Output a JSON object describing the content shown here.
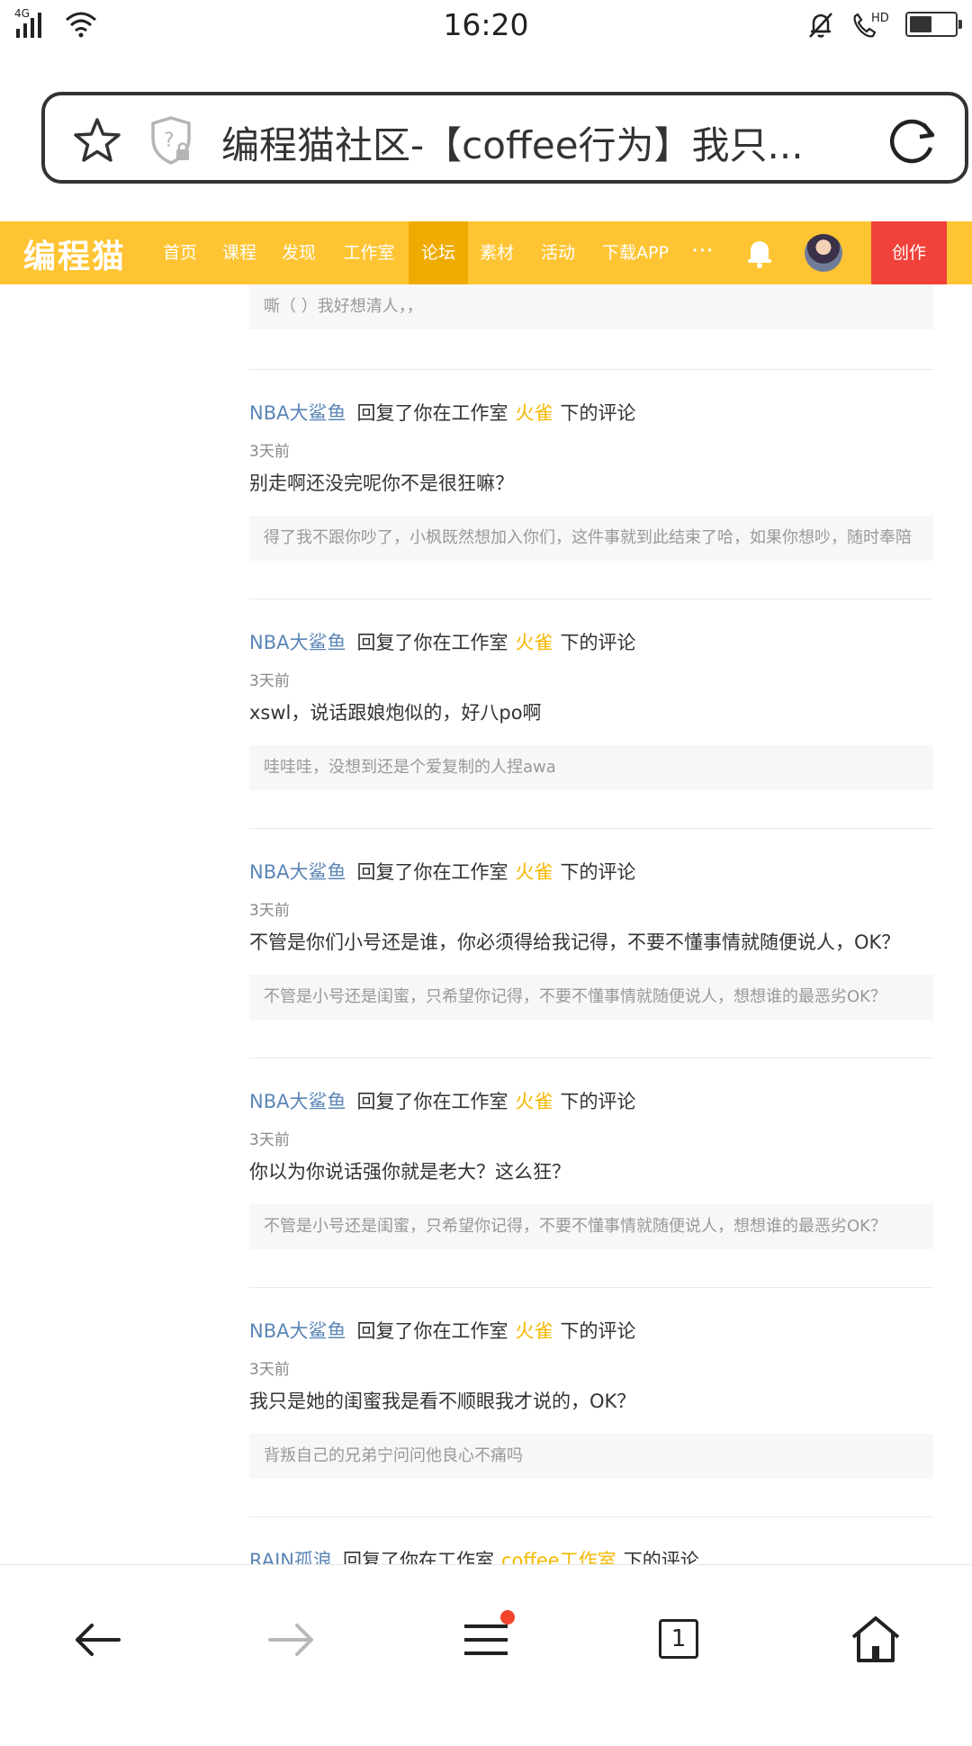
{
  "status_bar": {
    "network": "4G",
    "time": "16:20",
    "battery_level": 0.55
  },
  "address_bar": {
    "title": "编程猫社区-【coffee行为】我只..."
  },
  "site_nav": {
    "logo": "编程猫",
    "items": [
      "首页",
      "课程",
      "发现",
      "工作室",
      "论坛",
      "素材",
      "活动",
      "下载APP"
    ],
    "active_item": "论坛",
    "more": "···",
    "create_label": "创作"
  },
  "feed": {
    "top_quote": "嘶（ ）我好想清人，，",
    "notifications": [
      {
        "user": "NBA大鲨鱼",
        "action": "回复了你在工作室",
        "studio": "火雀",
        "suffix": "下的评论",
        "time": "3天前",
        "message": "别走啊还没完呢你不是很狂嘛？",
        "quote": "得了我不跟你吵了，小枫既然想加入你们，这件事就到此结束了哈，如果你想吵，随时奉陪"
      },
      {
        "user": "NBA大鲨鱼",
        "action": "回复了你在工作室",
        "studio": "火雀",
        "suffix": "下的评论",
        "time": "3天前",
        "message": "xswl，说话跟娘炮似的，好八po啊",
        "quote": "哇哇哇，没想到还是个爱复制的人捏awa"
      },
      {
        "user": "NBA大鲨鱼",
        "action": "回复了你在工作室",
        "studio": "火雀",
        "suffix": "下的评论",
        "time": "3天前",
        "message": "不管是你们小号还是谁，你必须得给我记得，不要不懂事情就随便说人，OK？",
        "quote": "不管是小号还是闺蜜，只希望你记得，不要不懂事情就随便说人，想想谁的最恶劣OK？"
      },
      {
        "user": "NBA大鲨鱼",
        "action": "回复了你在工作室",
        "studio": "火雀",
        "suffix": "下的评论",
        "time": "3天前",
        "message": "你以为你说话强你就是老大？这么狂？",
        "quote": "不管是小号还是闺蜜，只希望你记得，不要不懂事情就随便说人，想想谁的最恶劣OK？"
      },
      {
        "user": "NBA大鲨鱼",
        "action": "回复了你在工作室",
        "studio": "火雀",
        "suffix": "下的评论",
        "time": "3天前",
        "message": "我只是她的闺蜜我是看不顺眼我才说的，OK？",
        "quote": "背叛自己的兄弟宁问问他良心不痛吗"
      },
      {
        "user": "RAIN孤浪",
        "action": "回复了你在工作室",
        "studio": "coffee工作室",
        "suffix": "下的评论",
        "time": "",
        "message": "",
        "quote": ""
      }
    ]
  },
  "bottom_bar": {
    "tab_count": "1"
  },
  "colors": {
    "nav_bg": "#fec433",
    "nav_active": "#f0ab00",
    "create_bg": "#f0413a",
    "user_link": "#5b86b6",
    "studio_link": "#f5b800"
  }
}
